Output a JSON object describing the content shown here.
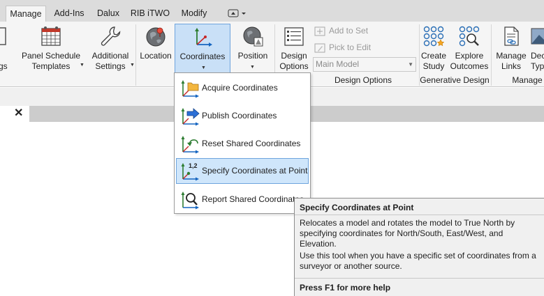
{
  "tabs": [
    {
      "label": "Manage",
      "active": true
    },
    {
      "label": "Add-Ins"
    },
    {
      "label": "Dalux"
    },
    {
      "label": "RIB iTWO"
    },
    {
      "label": "Modify"
    }
  ],
  "ribbon": {
    "buttons": {
      "partial_left": {
        "line2": "gs"
      },
      "panel_schedule": {
        "line1": "Panel Schedule",
        "line2": "Templates"
      },
      "additional_settings": {
        "line1": "Additional",
        "line2": "Settings"
      },
      "location": {
        "line1": "Location"
      },
      "coordinates": {
        "line1": "Coordinates"
      },
      "position": {
        "line1": "Position"
      },
      "design_options": {
        "line1": "Design",
        "line2": "Options"
      },
      "create_study": {
        "line1": "Create",
        "line2": "Study"
      },
      "explore_outcomes": {
        "line1": "Explore",
        "line2": "Outcomes"
      },
      "manage_links": {
        "line1": "Manage",
        "line2": "Links"
      },
      "partial_right": {
        "line1": "Dec",
        "line2": "Typ"
      }
    },
    "small_buttons": {
      "add_to_set": "Add to Set",
      "pick_to_edit": "Pick to Edit"
    },
    "combo_value": "Main Model",
    "panels": {
      "design_options": "Design Options",
      "generative_design": "Generative Design",
      "manage": "Manage"
    }
  },
  "dropdown": {
    "items": [
      {
        "label": "Acquire Coordinates"
      },
      {
        "label": "Publish Coordinates"
      },
      {
        "label": "Reset Shared Coordinates"
      },
      {
        "label": "Specify Coordinates at Point",
        "highlighted": true,
        "badge": "1,2"
      },
      {
        "label": "Report Shared Coordinates"
      }
    ]
  },
  "tooltip": {
    "title": "Specify Coordinates at Point",
    "body1": "Relocates a model and rotates the model to True North by specifying coordinates for North/South, East/West, and Elevation.",
    "body2": "Use this tool when you have a specific set of coordinates from a surveyor or another source.",
    "help": "Press F1 for more help"
  },
  "view": {
    "close_glyph": "✕"
  },
  "colors": {
    "ribbon_bg": "#f5f5f5",
    "tab_bar_bg": "#dcdcdc",
    "pressed_bg": "#c9e0f7",
    "highlight_border": "#6ea4dd",
    "tooltip_bg": "#f0f0f0"
  }
}
